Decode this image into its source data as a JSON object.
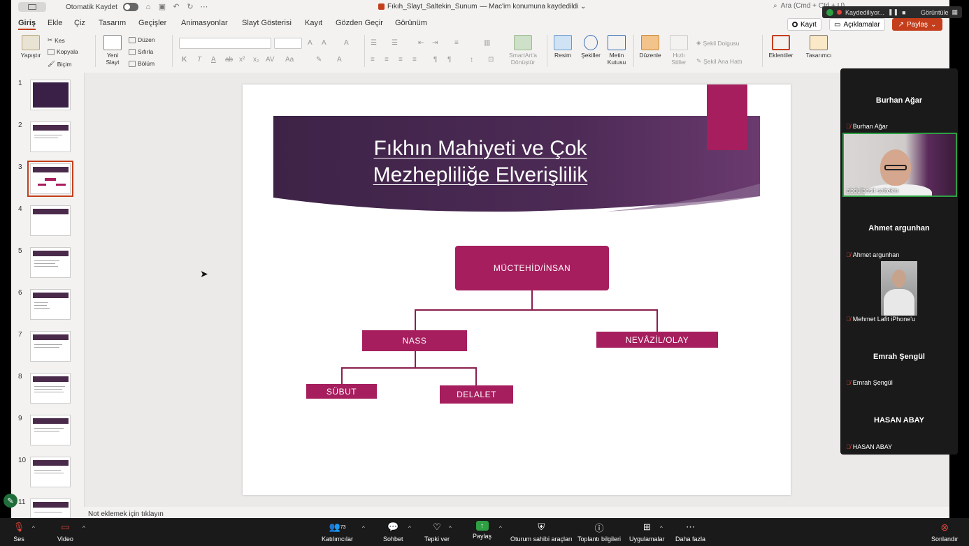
{
  "window": {
    "autosave_label": "Otomatik Kaydet",
    "doc_title": "Fıkıh_Slayt_Saltekin_Sunum",
    "doc_subtitle": "— Mac'im konumuna kaydedildi ⌄",
    "search_placeholder": "Ara (Cmd + Ctrl + U)"
  },
  "tabs": [
    "Giriş",
    "Ekle",
    "Çiz",
    "Tasarım",
    "Geçişler",
    "Animasyonlar",
    "Slayt Gösterisi",
    "Kayıt",
    "Gözden Geçir",
    "Görünüm"
  ],
  "actions": {
    "record": "Kayıt",
    "comments": "Açıklamalar",
    "share": "Paylaş"
  },
  "ribbon": {
    "paste": "Yapıştır",
    "cut": "Kes",
    "copy": "Kopyala",
    "format": "Biçim",
    "new_slide_1": "Yeni",
    "new_slide_2": "Slayt",
    "layout": "Düzen",
    "reset": "Sıfırla",
    "section": "Bölüm",
    "smartart_1": "SmartArt'a",
    "smartart_2": "Dönüştür",
    "picture": "Resim",
    "shapes": "Şekiller",
    "textbox_1": "Metin",
    "textbox_2": "Kutusu",
    "arrange": "Düzenle",
    "quick_styles_1": "Hızlı",
    "quick_styles_2": "Stiller",
    "shape_fill": "Şekil Dolgusu",
    "shape_outline": "Şekil Ana Hattı",
    "addins": "Eklentiler",
    "designer": "Tasarımcı"
  },
  "thumbnails": [
    "1",
    "2",
    "3",
    "4",
    "5",
    "6",
    "7",
    "8",
    "9",
    "10",
    "11"
  ],
  "selected_slide": 3,
  "notes_placeholder": "Not eklemek için tıklayın",
  "slide": {
    "title_line1": "Fıkhın Mahiyeti ve Çok",
    "title_line2": "Mezhepliliğe Elverişlilik",
    "nodes": {
      "root": "MÜCTEHİD/İNSAN",
      "left": "NASS",
      "right": "NEVÂZİL/OLAY",
      "left_left": "SÜBUT",
      "left_right": "DELALET"
    }
  },
  "recording": {
    "status": "Kaydediliyor...",
    "view": "Görüntüle"
  },
  "participants": [
    {
      "big": "Burhan Ağar",
      "small": "Burhan Ağar"
    },
    {
      "video_label": "abdulbasit saltekin"
    },
    {
      "big": "Ahmet argunhan",
      "small": "Ahmet argunhan"
    },
    {
      "small": "Mehmet Lafit iPhone'u"
    },
    {
      "big": "Emrah Şengül",
      "small": "Emrah Şengül"
    },
    {
      "big": "HASAN ABAY",
      "small": "HASAN ABAY"
    }
  ],
  "zoom_bar": {
    "audio": "Ses",
    "video": "Video",
    "participants": "Katılımcılar",
    "participant_count": "73",
    "chat": "Sohbet",
    "react": "Tepki ver",
    "share": "Paylaş",
    "host_tools": "Oturum sahibi araçları",
    "meeting_info": "Toplantı bilgileri",
    "apps": "Uygulamalar",
    "more": "Daha fazla",
    "end": "Sonlandır"
  },
  "colors": {
    "accent": "#c43e1c",
    "slide_box": "#a61e5e",
    "title_band": "#4a2a52",
    "active_speaker": "#2ea043"
  }
}
